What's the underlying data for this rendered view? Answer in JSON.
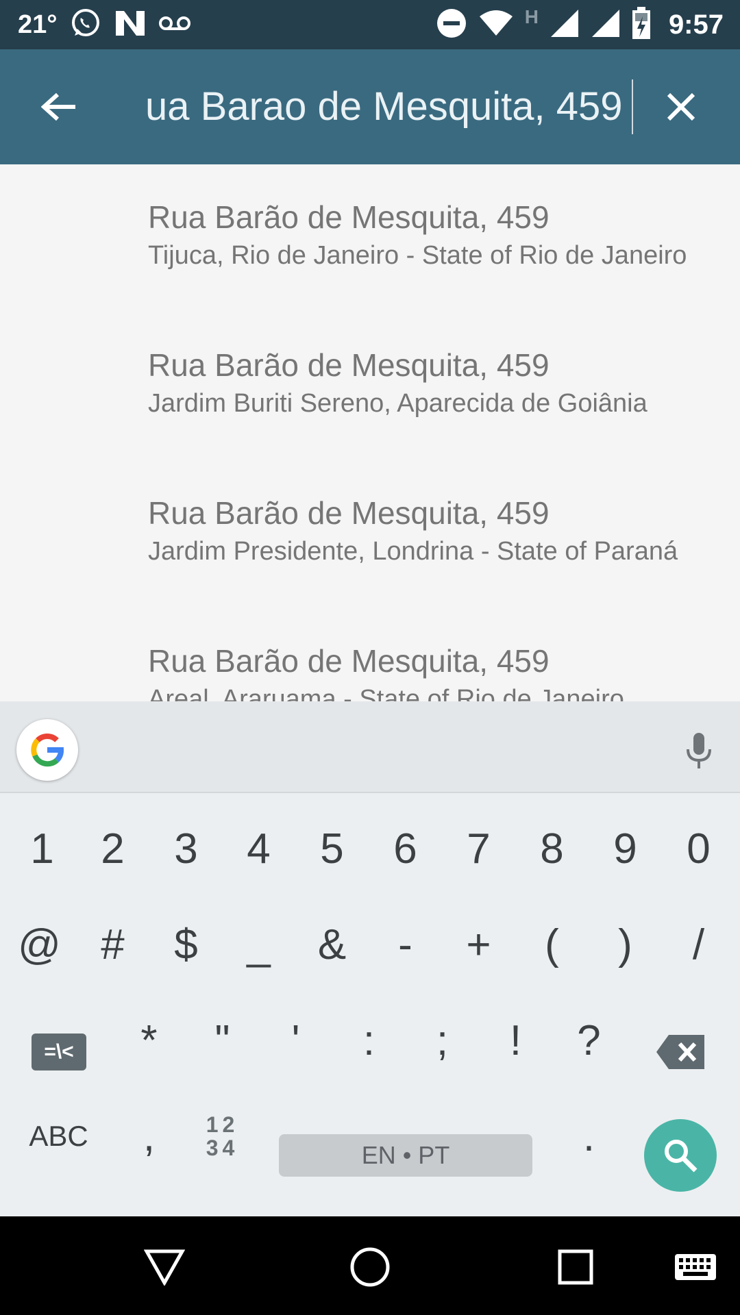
{
  "status_bar": {
    "temperature": "21°",
    "network_type": "H",
    "time": "9:57"
  },
  "app_bar": {
    "search_value": "ua Barao de Mesquita, 459"
  },
  "results": [
    {
      "title": "Rua Barão de Mesquita, 459",
      "subtitle": "Tijuca, Rio de Janeiro - State of Rio de Janeiro"
    },
    {
      "title": "Rua Barão de Mesquita, 459",
      "subtitle": "Jardim Buriti Sereno, Aparecida de Goiânia"
    },
    {
      "title": "Rua Barão de Mesquita, 459",
      "subtitle": "Jardim Presidente, Londrina - State of Paraná"
    },
    {
      "title": "Rua Barão de Mesquita, 459",
      "subtitle": "Areal, Araruama - State of Rio de Janeiro"
    }
  ],
  "keyboard": {
    "row1": [
      "1",
      "2",
      "3",
      "4",
      "5",
      "6",
      "7",
      "8",
      "9",
      "0"
    ],
    "row2": [
      "@",
      "#",
      "$",
      "_",
      "&",
      "-",
      "+",
      "(",
      ")",
      "/"
    ],
    "row3": [
      "*",
      "\"",
      "'",
      ":",
      ";",
      "!",
      "?"
    ],
    "alt_symbols_key": "=\\<",
    "abc_key": "ABC",
    "comma_key": ",",
    "numpad_key_top": "12",
    "numpad_key_bottom": "34",
    "space_label": "EN • PT",
    "period_key": "."
  },
  "colors": {
    "status_bar": "#263f4d",
    "app_bar": "#3a6a80",
    "search_key": "#4ab5a7"
  }
}
